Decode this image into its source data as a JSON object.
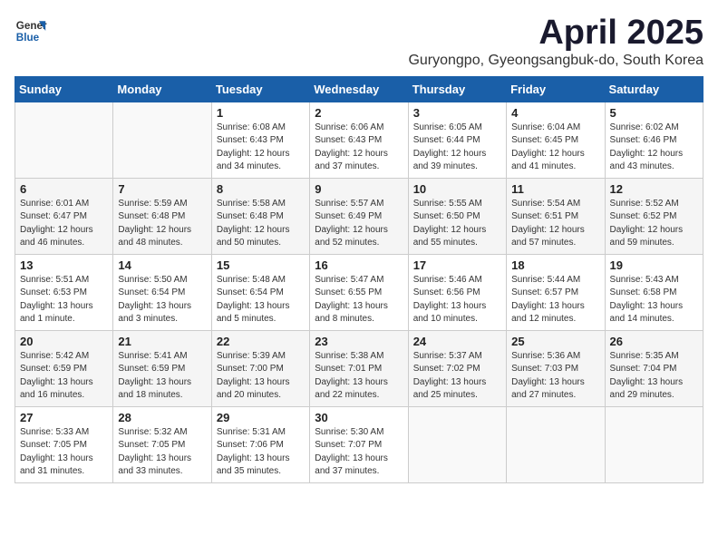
{
  "logo": {
    "general": "General",
    "blue": "Blue"
  },
  "title": "April 2025",
  "subtitle": "Guryongpo, Gyeongsangbuk-do, South Korea",
  "days_header": [
    "Sunday",
    "Monday",
    "Tuesday",
    "Wednesday",
    "Thursday",
    "Friday",
    "Saturday"
  ],
  "weeks": [
    [
      {
        "day": "",
        "info": ""
      },
      {
        "day": "",
        "info": ""
      },
      {
        "day": "1",
        "info": "Sunrise: 6:08 AM\nSunset: 6:43 PM\nDaylight: 12 hours and 34 minutes."
      },
      {
        "day": "2",
        "info": "Sunrise: 6:06 AM\nSunset: 6:43 PM\nDaylight: 12 hours and 37 minutes."
      },
      {
        "day": "3",
        "info": "Sunrise: 6:05 AM\nSunset: 6:44 PM\nDaylight: 12 hours and 39 minutes."
      },
      {
        "day": "4",
        "info": "Sunrise: 6:04 AM\nSunset: 6:45 PM\nDaylight: 12 hours and 41 minutes."
      },
      {
        "day": "5",
        "info": "Sunrise: 6:02 AM\nSunset: 6:46 PM\nDaylight: 12 hours and 43 minutes."
      }
    ],
    [
      {
        "day": "6",
        "info": "Sunrise: 6:01 AM\nSunset: 6:47 PM\nDaylight: 12 hours and 46 minutes."
      },
      {
        "day": "7",
        "info": "Sunrise: 5:59 AM\nSunset: 6:48 PM\nDaylight: 12 hours and 48 minutes."
      },
      {
        "day": "8",
        "info": "Sunrise: 5:58 AM\nSunset: 6:48 PM\nDaylight: 12 hours and 50 minutes."
      },
      {
        "day": "9",
        "info": "Sunrise: 5:57 AM\nSunset: 6:49 PM\nDaylight: 12 hours and 52 minutes."
      },
      {
        "day": "10",
        "info": "Sunrise: 5:55 AM\nSunset: 6:50 PM\nDaylight: 12 hours and 55 minutes."
      },
      {
        "day": "11",
        "info": "Sunrise: 5:54 AM\nSunset: 6:51 PM\nDaylight: 12 hours and 57 minutes."
      },
      {
        "day": "12",
        "info": "Sunrise: 5:52 AM\nSunset: 6:52 PM\nDaylight: 12 hours and 59 minutes."
      }
    ],
    [
      {
        "day": "13",
        "info": "Sunrise: 5:51 AM\nSunset: 6:53 PM\nDaylight: 13 hours and 1 minute."
      },
      {
        "day": "14",
        "info": "Sunrise: 5:50 AM\nSunset: 6:54 PM\nDaylight: 13 hours and 3 minutes."
      },
      {
        "day": "15",
        "info": "Sunrise: 5:48 AM\nSunset: 6:54 PM\nDaylight: 13 hours and 5 minutes."
      },
      {
        "day": "16",
        "info": "Sunrise: 5:47 AM\nSunset: 6:55 PM\nDaylight: 13 hours and 8 minutes."
      },
      {
        "day": "17",
        "info": "Sunrise: 5:46 AM\nSunset: 6:56 PM\nDaylight: 13 hours and 10 minutes."
      },
      {
        "day": "18",
        "info": "Sunrise: 5:44 AM\nSunset: 6:57 PM\nDaylight: 13 hours and 12 minutes."
      },
      {
        "day": "19",
        "info": "Sunrise: 5:43 AM\nSunset: 6:58 PM\nDaylight: 13 hours and 14 minutes."
      }
    ],
    [
      {
        "day": "20",
        "info": "Sunrise: 5:42 AM\nSunset: 6:59 PM\nDaylight: 13 hours and 16 minutes."
      },
      {
        "day": "21",
        "info": "Sunrise: 5:41 AM\nSunset: 6:59 PM\nDaylight: 13 hours and 18 minutes."
      },
      {
        "day": "22",
        "info": "Sunrise: 5:39 AM\nSunset: 7:00 PM\nDaylight: 13 hours and 20 minutes."
      },
      {
        "day": "23",
        "info": "Sunrise: 5:38 AM\nSunset: 7:01 PM\nDaylight: 13 hours and 22 minutes."
      },
      {
        "day": "24",
        "info": "Sunrise: 5:37 AM\nSunset: 7:02 PM\nDaylight: 13 hours and 25 minutes."
      },
      {
        "day": "25",
        "info": "Sunrise: 5:36 AM\nSunset: 7:03 PM\nDaylight: 13 hours and 27 minutes."
      },
      {
        "day": "26",
        "info": "Sunrise: 5:35 AM\nSunset: 7:04 PM\nDaylight: 13 hours and 29 minutes."
      }
    ],
    [
      {
        "day": "27",
        "info": "Sunrise: 5:33 AM\nSunset: 7:05 PM\nDaylight: 13 hours and 31 minutes."
      },
      {
        "day": "28",
        "info": "Sunrise: 5:32 AM\nSunset: 7:05 PM\nDaylight: 13 hours and 33 minutes."
      },
      {
        "day": "29",
        "info": "Sunrise: 5:31 AM\nSunset: 7:06 PM\nDaylight: 13 hours and 35 minutes."
      },
      {
        "day": "30",
        "info": "Sunrise: 5:30 AM\nSunset: 7:07 PM\nDaylight: 13 hours and 37 minutes."
      },
      {
        "day": "",
        "info": ""
      },
      {
        "day": "",
        "info": ""
      },
      {
        "day": "",
        "info": ""
      }
    ]
  ]
}
